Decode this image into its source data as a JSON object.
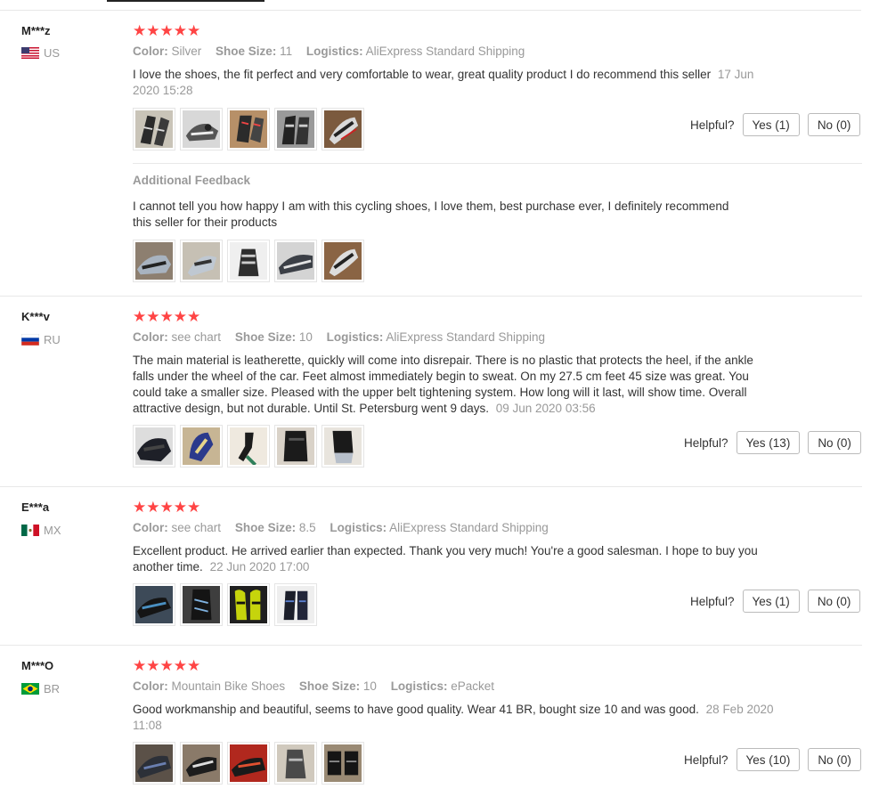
{
  "labels": {
    "color": "Color:",
    "shoe_size": "Shoe Size:",
    "logistics": "Logistics:",
    "helpful": "Helpful?",
    "additional_feedback": "Additional Feedback"
  },
  "reviews": [
    {
      "user": "M***z",
      "country": "US",
      "rating": 5,
      "color": "Silver",
      "shoe_size": "11",
      "logistics": "AliExpress Standard Shipping",
      "text": "I love the shoes, the fit perfect and very comfortable to wear, great quality product I do recommend this seller",
      "date": "17 Jun 2020 15:28",
      "yes": "Yes (1)",
      "no": "No (0)",
      "additional_text": "I cannot tell you how happy I am with this cycling shoes, I love them, best purchase ever, I definitely recommend this seller for their products"
    },
    {
      "user": "K***v",
      "country": "RU",
      "rating": 5,
      "color": "see chart",
      "shoe_size": "10",
      "logistics": "AliExpress Standard Shipping",
      "text": "The main material is leatherette, quickly will come into disrepair. There is no plastic that protects the heel, if the ankle falls under the wheel of the car. Feet almost immediately begin to sweat. On my 27.5 cm feet 45 size was great. You could take a smaller size. Pleased with the upper belt tightening system. How long will it last, will show time. Overall attractive design, but not durable. Until St. Petersburg went 9 days.",
      "date": "09 Jun 2020 03:56",
      "yes": "Yes (13)",
      "no": "No (0)"
    },
    {
      "user": "E***a",
      "country": "MX",
      "rating": 5,
      "color": "see chart",
      "shoe_size": "8.5",
      "logistics": "AliExpress Standard Shipping",
      "text": "Excellent product. He arrived earlier than expected. Thank you very much! You're a good salesman. I hope to buy you another time.",
      "date": "22 Jun 2020 17:00",
      "yes": "Yes (1)",
      "no": "No (0)"
    },
    {
      "user": "M***O",
      "country": "BR",
      "rating": 5,
      "color": "Mountain Bike Shoes",
      "shoe_size": "10",
      "logistics": "ePacket",
      "text": "Good workmanship and beautiful, seems to have good quality. Wear 41 BR, bought size 10 and was good.",
      "date": "28 Feb 2020 11:08",
      "yes": "Yes (10)",
      "no": "No (0)"
    }
  ],
  "colors": {
    "star": "#ff4747",
    "muted": "#999999",
    "text": "#333333"
  }
}
